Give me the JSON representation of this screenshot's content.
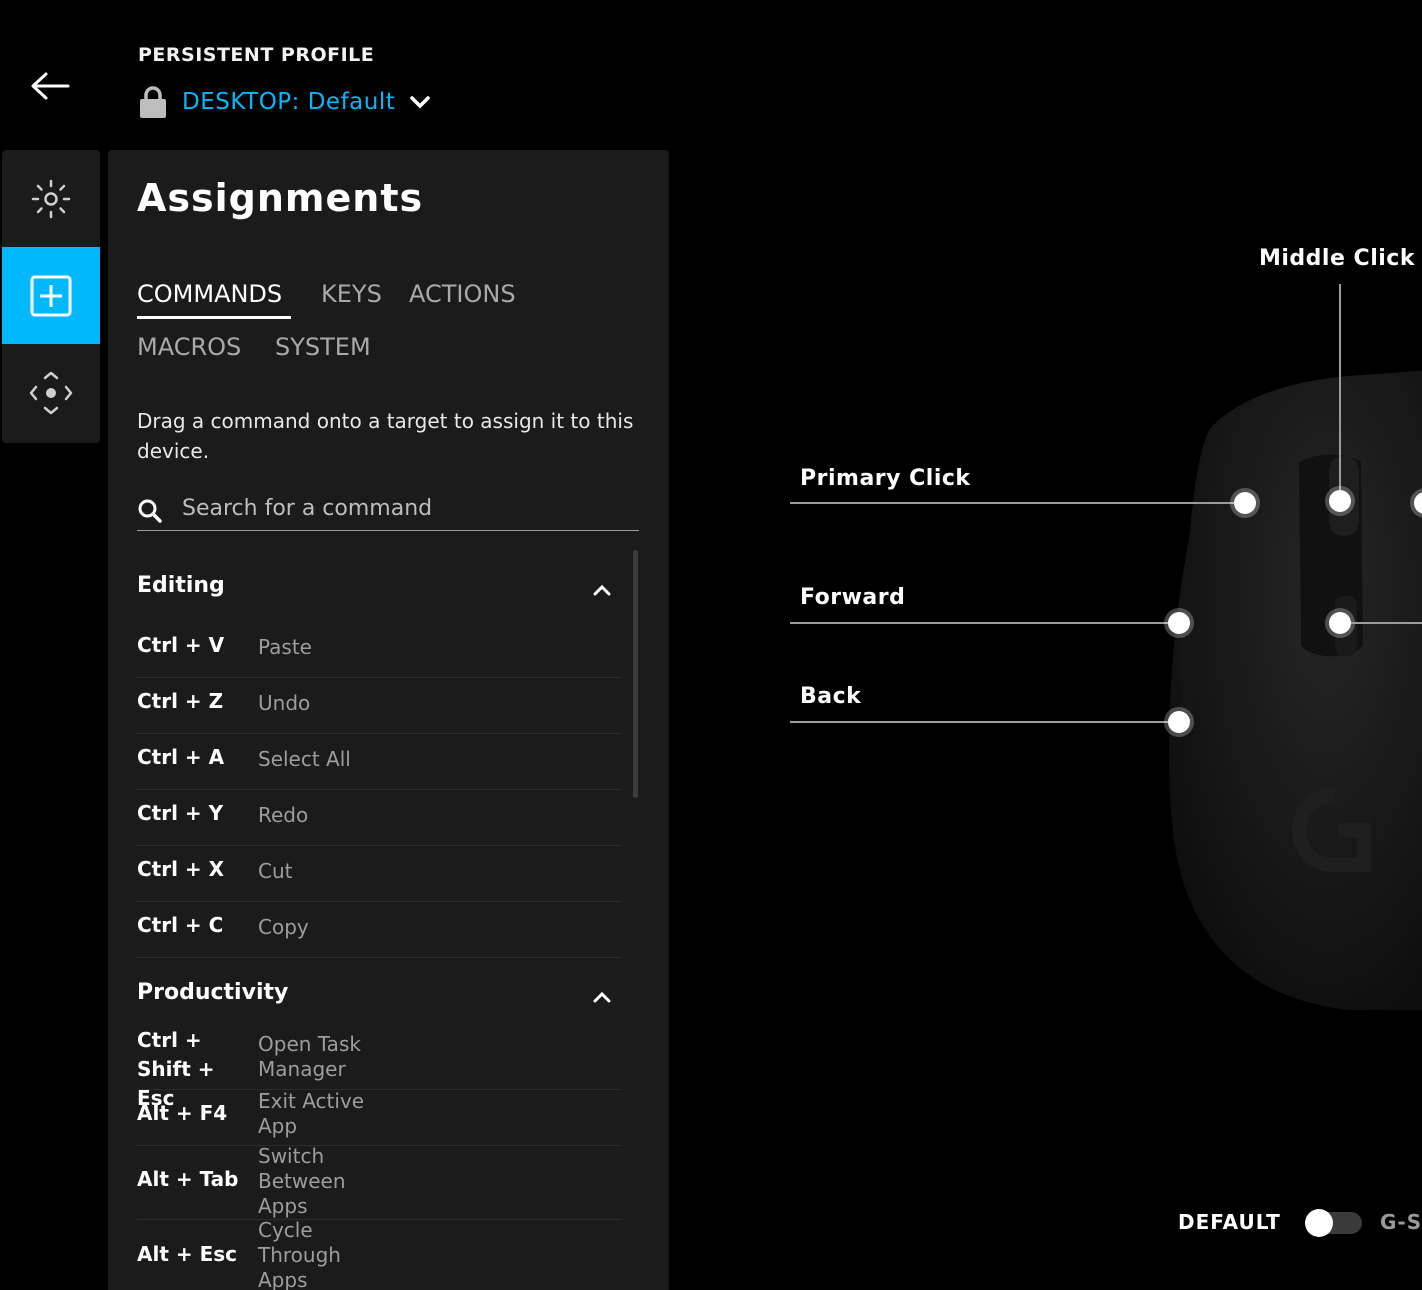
{
  "header": {
    "profile_caption": "PERSISTENT PROFILE",
    "profile_name": "DESKTOP: Default"
  },
  "rail": {
    "items": [
      {
        "name": "lighting",
        "icon": "sun-icon",
        "active": false
      },
      {
        "name": "assignments",
        "icon": "plus-box-icon",
        "active": true
      },
      {
        "name": "pointer",
        "icon": "move-arrows-icon",
        "active": false
      }
    ]
  },
  "panel": {
    "title": "Assignments",
    "tabs": [
      {
        "label": "COMMANDS",
        "active": true
      },
      {
        "label": "KEYS",
        "active": false
      },
      {
        "label": "ACTIONS",
        "active": false
      },
      {
        "label": "MACROS",
        "active": false
      },
      {
        "label": "SYSTEM",
        "active": false
      }
    ],
    "help_text": "Drag a command onto a target to assign it to this device.",
    "search_placeholder": "Search for a command",
    "sections": [
      {
        "title": "Editing",
        "items": [
          {
            "key": "Ctrl + V",
            "command": "Paste"
          },
          {
            "key": "Ctrl + Z",
            "command": "Undo"
          },
          {
            "key": "Ctrl + A",
            "command": "Select All"
          },
          {
            "key": "Ctrl + Y",
            "command": "Redo"
          },
          {
            "key": "Ctrl + X",
            "command": "Cut"
          },
          {
            "key": "Ctrl + C",
            "command": "Copy"
          }
        ]
      },
      {
        "title": "Productivity",
        "items": [
          {
            "key": "Ctrl + Shift + Esc",
            "command": "Open Task Manager"
          },
          {
            "key": "Alt + F4",
            "command": "Exit Active App"
          },
          {
            "key": "Alt + Tab",
            "command": "Switch Between Apps"
          },
          {
            "key": "Alt + Esc",
            "command": "Cycle Through Apps"
          }
        ]
      }
    ]
  },
  "device": {
    "callouts": {
      "middle": "Middle Click",
      "primary": "Primary Click",
      "forward": "Forward",
      "back": "Back"
    },
    "mode": {
      "left_label": "DEFAULT",
      "right_label": "G-S",
      "selected": "DEFAULT"
    }
  },
  "colors": {
    "accent": "#00b8fc",
    "panel_bg": "#1b1b1b",
    "background": "#000000"
  }
}
